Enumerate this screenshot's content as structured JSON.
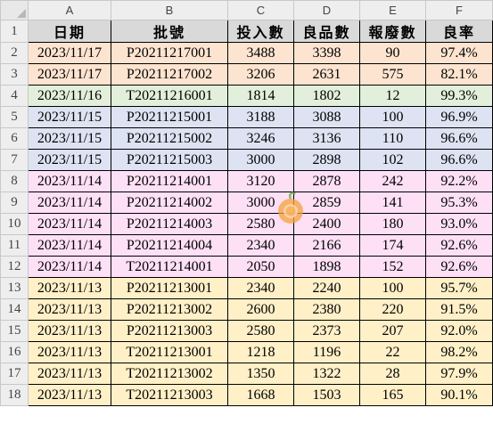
{
  "sheet": {
    "column_letters": [
      "A",
      "B",
      "C",
      "D",
      "E",
      "F"
    ],
    "row_numbers": [
      "1",
      "2",
      "3",
      "4",
      "5",
      "6",
      "7",
      "8",
      "9",
      "10",
      "11",
      "12",
      "13",
      "14",
      "15",
      "16",
      "17",
      "18"
    ],
    "header": [
      "日期",
      "批號",
      "投入數",
      "良品數",
      "報廢數",
      "良率"
    ],
    "rows": [
      {
        "group": "orange",
        "cells": [
          "2023/11/17",
          "P20211217001",
          "3488",
          "3398",
          "90",
          "97.4%"
        ]
      },
      {
        "group": "orange",
        "cells": [
          "2023/11/17",
          "P20211217002",
          "3206",
          "2631",
          "575",
          "82.1%"
        ]
      },
      {
        "group": "green",
        "cells": [
          "2023/11/16",
          "T20211216001",
          "1814",
          "1802",
          "12",
          "99.3%"
        ]
      },
      {
        "group": "blue",
        "cells": [
          "2023/11/15",
          "P20211215001",
          "3188",
          "3088",
          "100",
          "96.9%"
        ]
      },
      {
        "group": "blue",
        "cells": [
          "2023/11/15",
          "P20211215002",
          "3246",
          "3136",
          "110",
          "96.6%"
        ]
      },
      {
        "group": "blue",
        "cells": [
          "2023/11/15",
          "P20211215003",
          "3000",
          "2898",
          "102",
          "96.6%"
        ]
      },
      {
        "group": "pink",
        "cells": [
          "2023/11/14",
          "P20211214001",
          "3120",
          "2878",
          "242",
          "92.2%"
        ]
      },
      {
        "group": "pink",
        "cells": [
          "2023/11/14",
          "P20211214002",
          "3000",
          "2859",
          "141",
          "95.3%"
        ]
      },
      {
        "group": "pink",
        "cells": [
          "2023/11/14",
          "P20211214003",
          "2580",
          "2400",
          "180",
          "93.0%"
        ]
      },
      {
        "group": "pink",
        "cells": [
          "2023/11/14",
          "P20211214004",
          "2340",
          "2166",
          "174",
          "92.6%"
        ]
      },
      {
        "group": "pink",
        "cells": [
          "2023/11/14",
          "T20211214001",
          "2050",
          "1898",
          "152",
          "92.6%"
        ]
      },
      {
        "group": "yellow",
        "cells": [
          "2023/11/13",
          "P20211213001",
          "2340",
          "2240",
          "100",
          "95.7%"
        ]
      },
      {
        "group": "yellow",
        "cells": [
          "2023/11/13",
          "P20211213002",
          "2600",
          "2380",
          "220",
          "91.5%"
        ]
      },
      {
        "group": "yellow",
        "cells": [
          "2023/11/13",
          "P20211213003",
          "2580",
          "2373",
          "207",
          "92.0%"
        ]
      },
      {
        "group": "yellow",
        "cells": [
          "2023/11/13",
          "T20211213001",
          "1218",
          "1196",
          "22",
          "98.2%"
        ]
      },
      {
        "group": "yellow",
        "cells": [
          "2023/11/13",
          "T20211213002",
          "1350",
          "1322",
          "28",
          "97.9%"
        ]
      },
      {
        "group": "yellow",
        "cells": [
          "2023/11/13",
          "T20211213003",
          "1668",
          "1503",
          "165",
          "90.1%"
        ]
      }
    ],
    "group_colors": {
      "orange": "#fde4d0",
      "green": "#e2efda",
      "blue": "#dde3f2",
      "pink": "#fde0f6",
      "yellow": "#fff0c8"
    },
    "watermark_icon": "orange-fruit-icon"
  }
}
